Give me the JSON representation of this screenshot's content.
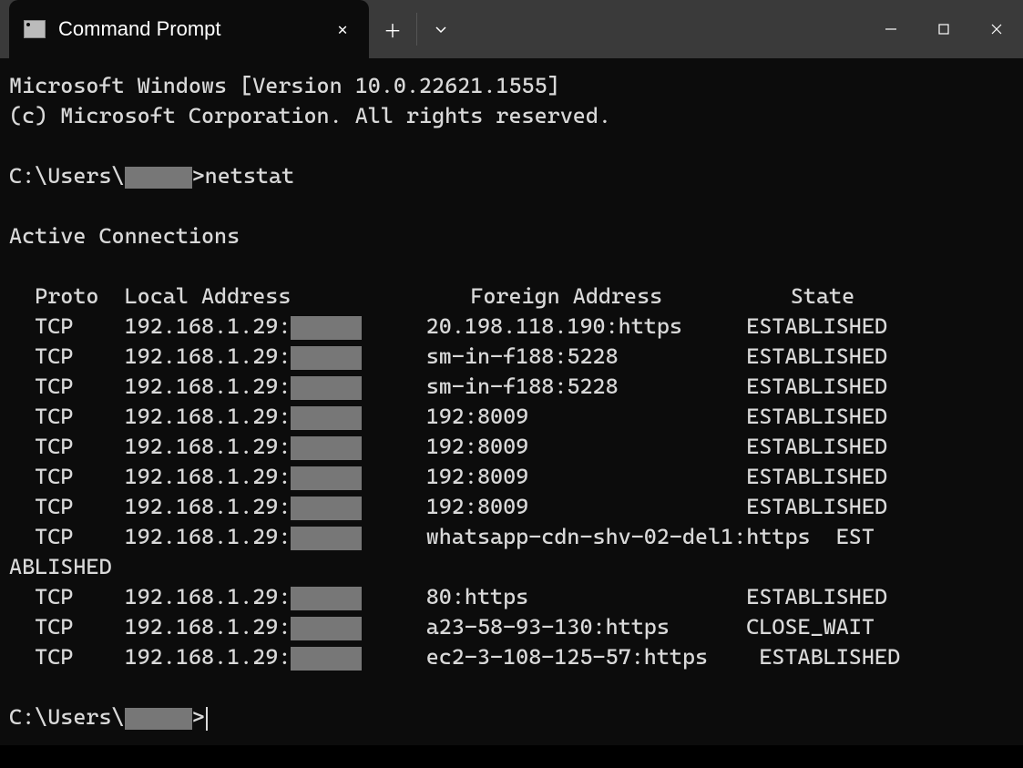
{
  "titlebar": {
    "tab_title": "Command Prompt"
  },
  "banner": {
    "line1": "Microsoft Windows [Version 10.0.22621.1555]",
    "line2": "(c) Microsoft Corporation. All rights reserved."
  },
  "prompt": {
    "prefix": "C:\\Users\\",
    "suffix": ">",
    "command": "netstat"
  },
  "output": {
    "header": "Active Connections",
    "columns": {
      "proto": "Proto",
      "local": "Local Address",
      "foreign": "Foreign Address",
      "state": "State"
    },
    "local_ip": "192.168.1.29:",
    "rows": [
      {
        "proto": "TCP",
        "foreign": "20.198.118.190:https",
        "state": "ESTABLISHED"
      },
      {
        "proto": "TCP",
        "foreign": "sm-in-f188:5228",
        "state": "ESTABLISHED"
      },
      {
        "proto": "TCP",
        "foreign": "sm-in-f188:5228",
        "state": "ESTABLISHED"
      },
      {
        "proto": "TCP",
        "foreign": "192:8009",
        "state": "ESTABLISHED"
      },
      {
        "proto": "TCP",
        "foreign": "192:8009",
        "state": "ESTABLISHED"
      },
      {
        "proto": "TCP",
        "foreign": "192:8009",
        "state": "ESTABLISHED"
      },
      {
        "proto": "TCP",
        "foreign": "192:8009",
        "state": "ESTABLISHED"
      },
      {
        "proto": "TCP",
        "foreign": "whatsapp-cdn-shv-02-del1:https",
        "state": "ESTABLISHED",
        "wrap": true
      },
      {
        "proto": "TCP",
        "foreign": "80:https",
        "state": "ESTABLISHED"
      },
      {
        "proto": "TCP",
        "foreign": "a23-58-93-130:https",
        "state": "CLOSE_WAIT"
      },
      {
        "proto": "TCP",
        "foreign": "ec2-3-108-125-57:https",
        "state": "ESTABLISHED",
        "tight": true
      }
    ]
  }
}
